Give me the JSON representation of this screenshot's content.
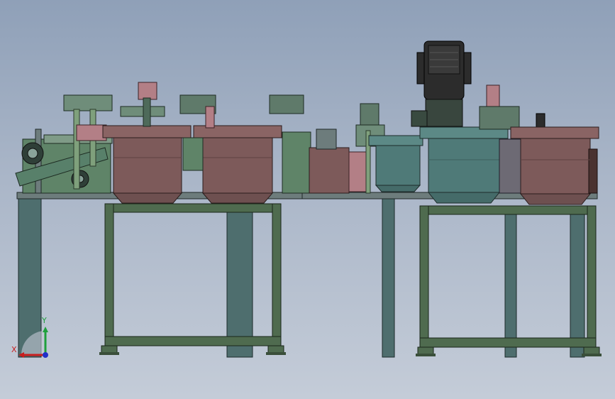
{
  "viewport": {
    "background_top": "#8fa0b8",
    "background_bottom": "#c4ccd8"
  },
  "triad": {
    "x_label": "X",
    "y_label": "Y",
    "x_color": "#c81e1e",
    "y_color": "#1fa03c",
    "z_color": "#2030c8"
  },
  "colors": {
    "frame_green": "#4f6b4f",
    "leg_teal": "#4e6e6e",
    "bin_brown": "#7d5a5a",
    "bin_teal": "#4f7a78",
    "motor_dark": "#2c2c2c",
    "mechanism_green": "#5f8468",
    "plate_gray": "#6d7c7c",
    "accent_pink": "#b37f86"
  }
}
